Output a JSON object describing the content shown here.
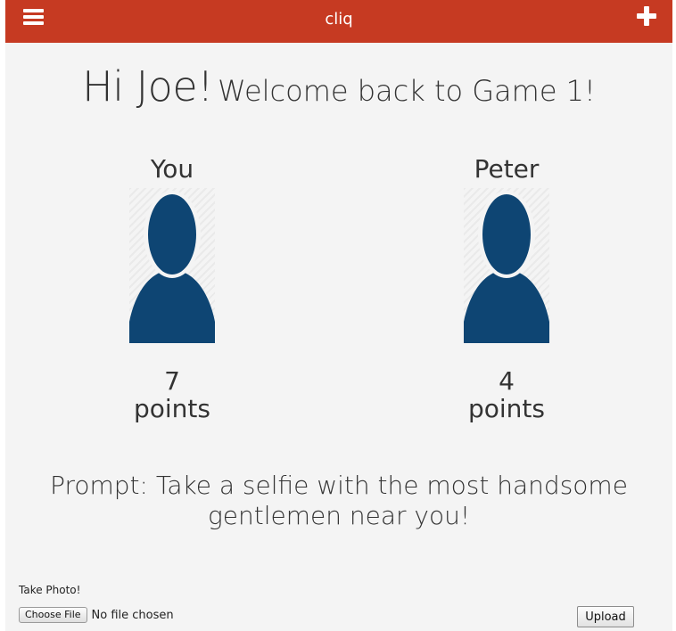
{
  "navbar": {
    "brand": "cliq",
    "menu_icon": "hamburger-menu-icon",
    "add_icon": "plus-icon",
    "color": "#c63a22"
  },
  "greeting": {
    "hi": "Hi Joe!",
    "welcome": "Welcome back to Game 1!"
  },
  "players": [
    {
      "name": "You",
      "score": "7",
      "points_label": "points",
      "avatar_icon": "person-silhouette-icon"
    },
    {
      "name": "Peter",
      "score": "4",
      "points_label": "points",
      "avatar_icon": "person-silhouette-icon"
    }
  ],
  "prompt": {
    "text": "Prompt: Take a selfie with the most handsome gentlemen near you!"
  },
  "upload_form": {
    "label": "Take Photo!",
    "choose_file_label": "Choose File",
    "file_status": "No file chosen",
    "upload_label": "Upload"
  },
  "colors": {
    "avatar": "#0e4573",
    "background": "#f4f4f4"
  }
}
